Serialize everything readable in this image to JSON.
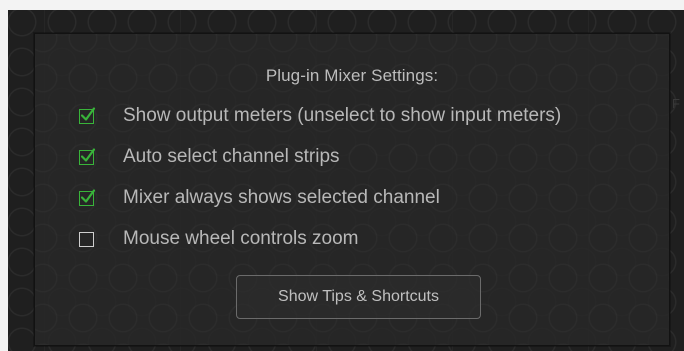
{
  "background": {
    "edge_letter": "F"
  },
  "dialog": {
    "title": "Plug-in Mixer Settings:",
    "options": [
      {
        "label": "Show output meters (unselect to show input meters)",
        "checked": true
      },
      {
        "label": "Auto select channel strips",
        "checked": true
      },
      {
        "label": "Mixer always shows selected channel",
        "checked": true
      },
      {
        "label": "Mouse wheel controls zoom",
        "checked": false
      }
    ],
    "button_label": "Show Tips & Shortcuts"
  },
  "colors": {
    "check": "#39b43a",
    "panel": "#282828",
    "text": "#b8b8b8"
  }
}
